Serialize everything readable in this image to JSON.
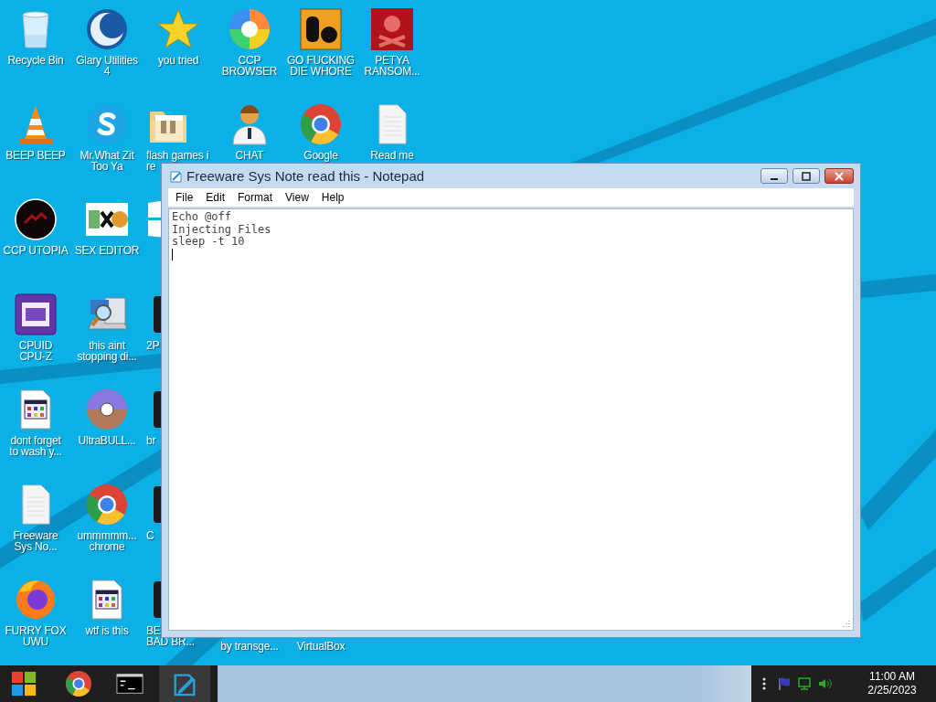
{
  "desktop": {
    "columns": [
      {
        "icons": [
          {
            "kind": "bin",
            "label": "Recycle Bin",
            "covered": false
          },
          {
            "kind": "cone",
            "label": "BEEP BEEP",
            "covered": false
          },
          {
            "kind": "darkcircle",
            "label": "CCP UTOPIA",
            "covered": false
          },
          {
            "kind": "chip",
            "label": "CPUID\nCPU-Z",
            "covered": false
          },
          {
            "kind": "gridfile",
            "label": "dont forget\nto wash y...",
            "covered": false
          },
          {
            "kind": "document",
            "label": "Freeware\nSys No...",
            "covered": false
          },
          {
            "kind": "fox",
            "label": "FURRY FOX\nUWU",
            "covered": false
          }
        ]
      },
      {
        "icons": [
          {
            "kind": "moon",
            "label": "Glary Utilities\n4",
            "covered": false
          },
          {
            "kind": "bubble",
            "label": "Mr.What Zit\nToo Ya",
            "covered": false
          },
          {
            "kind": "hex",
            "label": "SEX EDITOR",
            "covered": false
          },
          {
            "kind": "computer",
            "label": "this aint\nstopping di...",
            "covered": false
          },
          {
            "kind": "disc",
            "label": "UltraBULL...",
            "covered": false
          },
          {
            "kind": "browser",
            "label": "ummmmm...\nchrome",
            "covered": false
          },
          {
            "kind": "gridfile",
            "label": "wtf is this",
            "covered": false
          }
        ]
      },
      {
        "icons": [
          {
            "kind": "star",
            "label": "you tried",
            "covered": false
          },
          {
            "kind": "folder",
            "label": "flash games i\nre",
            "covered": true
          },
          {
            "kind": "panes",
            "covered": true
          },
          {
            "kind": "dark",
            "label": "2P",
            "covered": true
          },
          {
            "kind": "dark",
            "label": "br",
            "covered": true
          },
          {
            "kind": "dark",
            "label": "C",
            "covered": true
          },
          {
            "kind": "dark",
            "label": "BE\nBAD BR...",
            "covered": true
          }
        ]
      },
      {
        "icons": [
          {
            "kind": "swirl",
            "label": "CCP\nBROWSER",
            "covered": false
          },
          {
            "kind": "person",
            "label": "CHAT",
            "covered": false
          },
          {
            "kind": "labelonly",
            "label": "by transge...",
            "covered": false
          }
        ]
      },
      {
        "icons": [
          {
            "kind": "tile",
            "label": "GO FUCKING\nDIE WHORE",
            "covered": false
          },
          {
            "kind": "browser",
            "label": "Google",
            "covered": false
          },
          {
            "kind": "labelonly",
            "label": "VirtualBox",
            "covered": false
          }
        ]
      },
      {
        "icons": [
          {
            "kind": "skull",
            "label": "PETYA\nRANSOM...",
            "covered": false
          },
          {
            "kind": "document",
            "label": "Read me",
            "covered": false
          }
        ]
      }
    ]
  },
  "notepad": {
    "title": "Freeware Sys Note read this - Notepad",
    "menu": [
      "File",
      "Edit",
      "Format",
      "View",
      "Help"
    ],
    "content": "Echo @off\nInjecting Files\nsleep -t 10"
  },
  "taskbar": {
    "buttons": [
      {
        "kind": "start",
        "selected": false
      },
      {
        "kind": "browser",
        "selected": false
      },
      {
        "kind": "terminal",
        "selected": false
      },
      {
        "kind": "notepad",
        "selected": true
      }
    ],
    "clock": {
      "time": "11:00 AM",
      "date": "2/25/2023"
    }
  }
}
